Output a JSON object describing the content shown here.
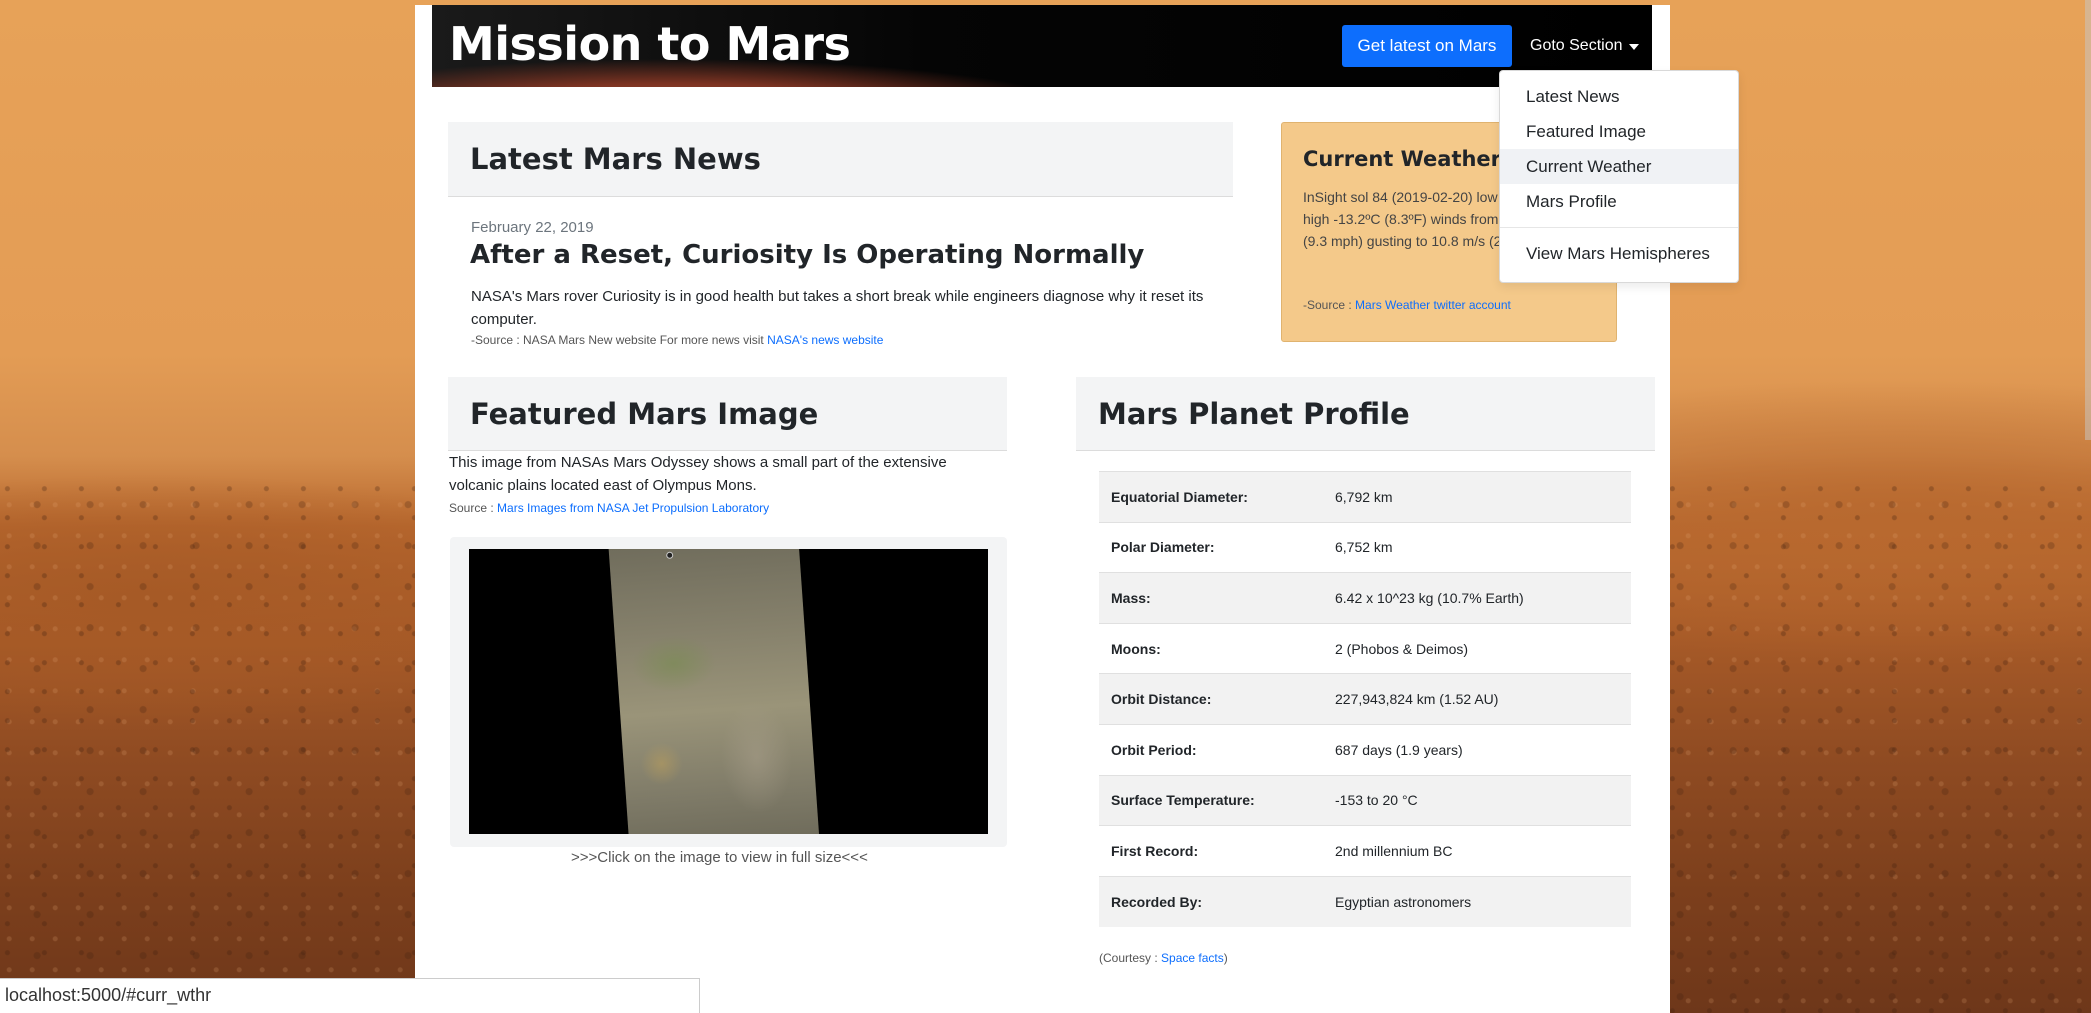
{
  "banner": {
    "title": "Mission to Mars",
    "latest_button": "Get latest on Mars",
    "goto_label": "Goto Section"
  },
  "dropdown": {
    "items": [
      "Latest News",
      "Featured Image",
      "Current Weather",
      "Mars Profile"
    ],
    "extra": "View Mars Hemispheres",
    "active_index": 2
  },
  "news": {
    "heading": "Latest Mars News",
    "date": "February 22, 2019",
    "title": "After a Reset, Curiosity Is Operating Normally",
    "body": "NASA's Mars rover Curiosity is in good health but takes a short break while engineers diagnose why it reset its computer.",
    "source_prefix": "-Source : NASA Mars New website For more news visit ",
    "source_link": "NASA's news website"
  },
  "weather": {
    "heading": "Current Weather on Mars",
    "text": "InSight sol 84 (2019-02-20) low -95.4ºC (-139.2ºF) high -13.2ºC (8.3ºF) winds from the SW at 4.1 m/s (9.3 mph) gusting to 10.8 m/s (24.2 mph)",
    "source_prefix": "-Source : ",
    "source_link": "Mars Weather twitter account"
  },
  "featured": {
    "heading": "Featured Mars Image",
    "description": "This image from NASAs Mars Odyssey shows a small part of the extensive volcanic plains located east of Olympus Mons.",
    "source_prefix": "Source : ",
    "source_link": "Mars Images from NASA Jet Propulsion Laboratory",
    "caption": ">>>Click on the image to view in full size<<<"
  },
  "profile": {
    "heading": "Mars Planet Profile",
    "rows": [
      {
        "key": "Equatorial Diameter:",
        "value": "6,792 km"
      },
      {
        "key": "Polar Diameter:",
        "value": "6,752 km"
      },
      {
        "key": "Mass:",
        "value": "6.42 x 10^23 kg (10.7% Earth)"
      },
      {
        "key": "Moons:",
        "value": "2 (Phobos & Deimos)"
      },
      {
        "key": "Orbit Distance:",
        "value": "227,943,824 km (1.52 AU)"
      },
      {
        "key": "Orbit Period:",
        "value": "687 days (1.9 years)"
      },
      {
        "key": "Surface Temperature:",
        "value": "-153 to 20 °C"
      },
      {
        "key": "First Record:",
        "value": "2nd millennium BC"
      },
      {
        "key": "Recorded By:",
        "value": "Egyptian astronomers"
      }
    ],
    "courtesy_prefix": "(Courtesy : ",
    "courtesy_link": "Space facts",
    "courtesy_suffix": ")"
  },
  "statusbar": {
    "url": "localhost:5000/#curr_wthr"
  },
  "colors": {
    "primary": "#0d6efd",
    "weather_bg": "#f4c98a",
    "jumbotron_bg": "#f3f4f5"
  }
}
